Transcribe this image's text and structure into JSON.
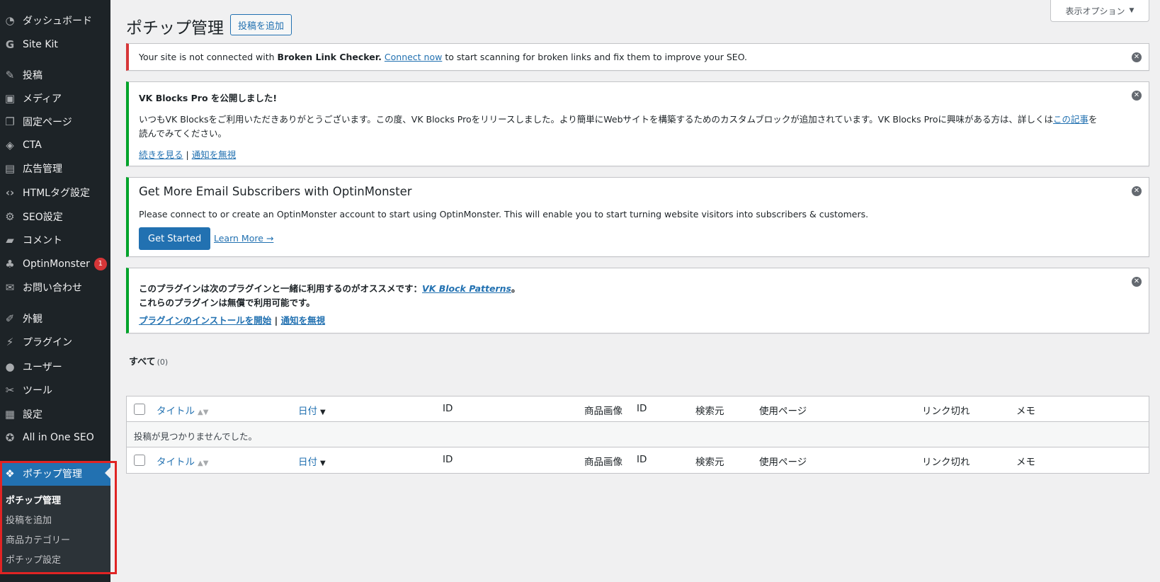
{
  "sidebar": {
    "items": [
      {
        "label": "ダッシュボード",
        "icon": "dashboard-icon"
      },
      {
        "label": "Site Kit",
        "icon": "google-g-icon"
      },
      {
        "label": "投稿",
        "icon": "post-edit-icon"
      },
      {
        "label": "メディア",
        "icon": "media-icon"
      },
      {
        "label": "固定ページ",
        "icon": "page-icon"
      },
      {
        "label": "CTA",
        "icon": "tag-icon"
      },
      {
        "label": "広告管理",
        "icon": "ad-icon"
      },
      {
        "label": "HTMLタグ設定",
        "icon": "code-icon"
      },
      {
        "label": "SEO設定",
        "icon": "gear-icon"
      },
      {
        "label": "コメント",
        "icon": "comment-icon"
      },
      {
        "label": "OptinMonster",
        "icon": "monster-icon",
        "badge": "1"
      },
      {
        "label": "お問い合わせ",
        "icon": "mail-icon"
      },
      {
        "label": "外観",
        "icon": "brush-icon"
      },
      {
        "label": "プラグイン",
        "icon": "plugin-icon"
      },
      {
        "label": "ユーザー",
        "icon": "user-icon"
      },
      {
        "label": "ツール",
        "icon": "wrench-icon"
      },
      {
        "label": "設定",
        "icon": "settings-icon"
      },
      {
        "label": "All in One SEO",
        "icon": "aioseo-icon"
      },
      {
        "label": "ポチップ管理",
        "icon": "paw-icon",
        "active": true
      }
    ],
    "submenu": [
      {
        "label": "ポチップ管理",
        "current": true
      },
      {
        "label": "投稿を追加"
      },
      {
        "label": "商品カテゴリー"
      },
      {
        "label": "ポチップ設定"
      }
    ]
  },
  "header": {
    "title": "ポチップ管理",
    "add_new": "投稿を追加",
    "screen_options": "表示オプション"
  },
  "notices": {
    "blc": {
      "pre": "Your site is not connected with ",
      "strong": "Broken Link Checker.",
      "link": "Connect now",
      "post": " to start scanning for broken links and fix them to improve your SEO."
    },
    "vk": {
      "title": "VK Blocks Pro を公開しました!",
      "body_1": "いつもVK Blocksをご利用いただきありがとうございます。この度、VK Blocks Proをリリースしました。より簡単にWebサイトを構築するためのカスタムブロックが追加されています。VK Blocks Proに興味がある方は、詳しくは",
      "body_link": "この記事",
      "body_2": "を",
      "body_3": "読んでみてください。",
      "link_more": "続きを見る",
      "sep": "|",
      "link_dismiss": "通知を無視"
    },
    "om": {
      "title": "Get More Email Subscribers with OptinMonster",
      "body": "Please connect to or create an OptinMonster account to start using OptinMonster. This will enable you to start turning website visitors into subscribers & customers.",
      "button": "Get Started",
      "link": "Learn More →"
    },
    "vkp": {
      "line1_pre": "このプラグインは次のプラグインと一緒に利用するのがオススメです：",
      "line1_link": "VK Block Patterns",
      "line1_post": "。",
      "line2": "これらのプラグインは無償で利用可能です。",
      "link_install": "プラグインのインストールを開始",
      "sep": "|",
      "link_dismiss": "通知を無視"
    }
  },
  "views": {
    "all": "すべて",
    "count": "(0)"
  },
  "table": {
    "columns": [
      "タイトル",
      "日付",
      "ID",
      "商品画像",
      "ID",
      "検索元",
      "使用ページ",
      "リンク切れ",
      "メモ"
    ],
    "empty_message": "投稿が見つかりませんでした。"
  },
  "colors": {
    "sidebar_bg": "#1d2327",
    "accent": "#2271b1",
    "error": "#d63638",
    "success": "#00a32a",
    "highlight": "#e02424"
  }
}
